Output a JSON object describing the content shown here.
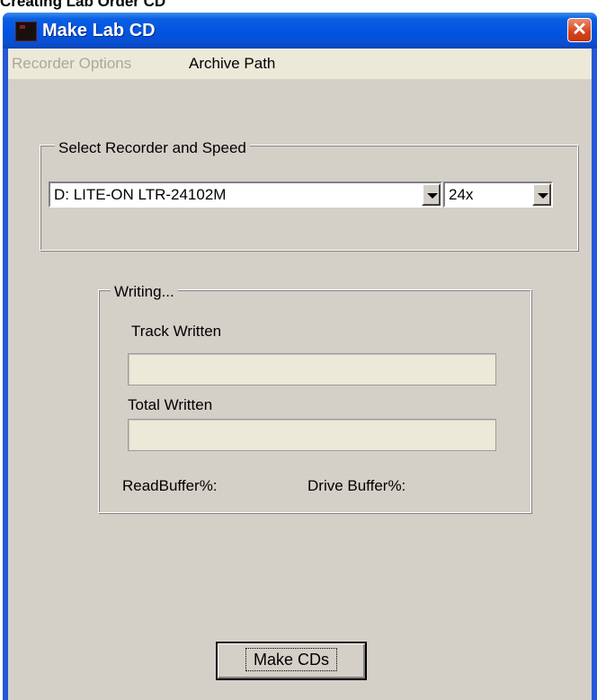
{
  "doc_heading": "Creating Lab Order CD",
  "window": {
    "title": "Make Lab CD",
    "icon": "app-icon",
    "close_glyph": "✕"
  },
  "menu": {
    "items": [
      {
        "label": "Recorder Options",
        "enabled": false
      },
      {
        "label": "Archive Path",
        "enabled": true
      }
    ]
  },
  "recorder_group": {
    "legend": "Select Recorder and Speed",
    "recorder_value": "D: LITE-ON LTR-24102M",
    "speed_value": "24x"
  },
  "writing_group": {
    "legend": "Writing...",
    "track_label": "Track Written",
    "track_progress": 0,
    "total_label": "Total Written",
    "total_progress": 0,
    "read_buffer_label": "ReadBuffer%:",
    "drive_buffer_label": "Drive Buffer%:"
  },
  "actions": {
    "make_cds": "Make CDs"
  },
  "colors": {
    "titlebar": "#0054e3",
    "window_bg": "#d4d0c8",
    "menubar_bg": "#ece9d8",
    "progress_bg": "#ece9d8"
  }
}
